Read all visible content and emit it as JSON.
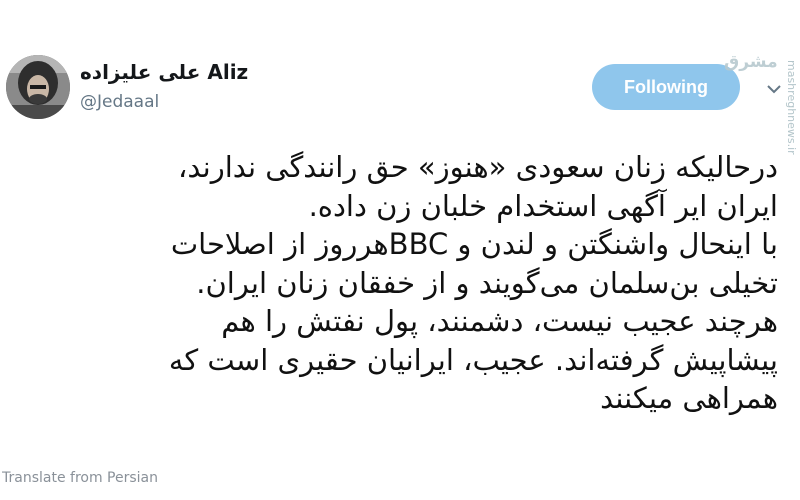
{
  "user": {
    "display_name": "علی علیزاده Aliz",
    "handle": "@Jedaaal"
  },
  "follow_button": {
    "label": "Following"
  },
  "watermark": {
    "logo_text": "مشرق",
    "url": "mashreghnews.ir"
  },
  "tweet": {
    "lines": [
      "درحالیکه زنان سعودی «هنوز» حق رانندگی ندارند،",
      "ایران ایر آگهی استخدام خلبان زن داده.",
      "با اینحال واشنگتن و لندن و BBCهرروز از اصلاحات",
      "تخیلی بن‌سلمان می‌گویند و از خفقان زنان ایران.",
      "هرچند عجیب نیست، دشمنند، پول نفتش را هم",
      "پیشاپیش گرفته‌اند. عجیب، ایرانیان حقیری است که",
      "همراهی میکنند"
    ]
  },
  "footer": {
    "text": "Translate from Persian"
  },
  "colors": {
    "follow_bg": "#8fc6ec",
    "handle": "#657786",
    "text": "#14171a"
  }
}
